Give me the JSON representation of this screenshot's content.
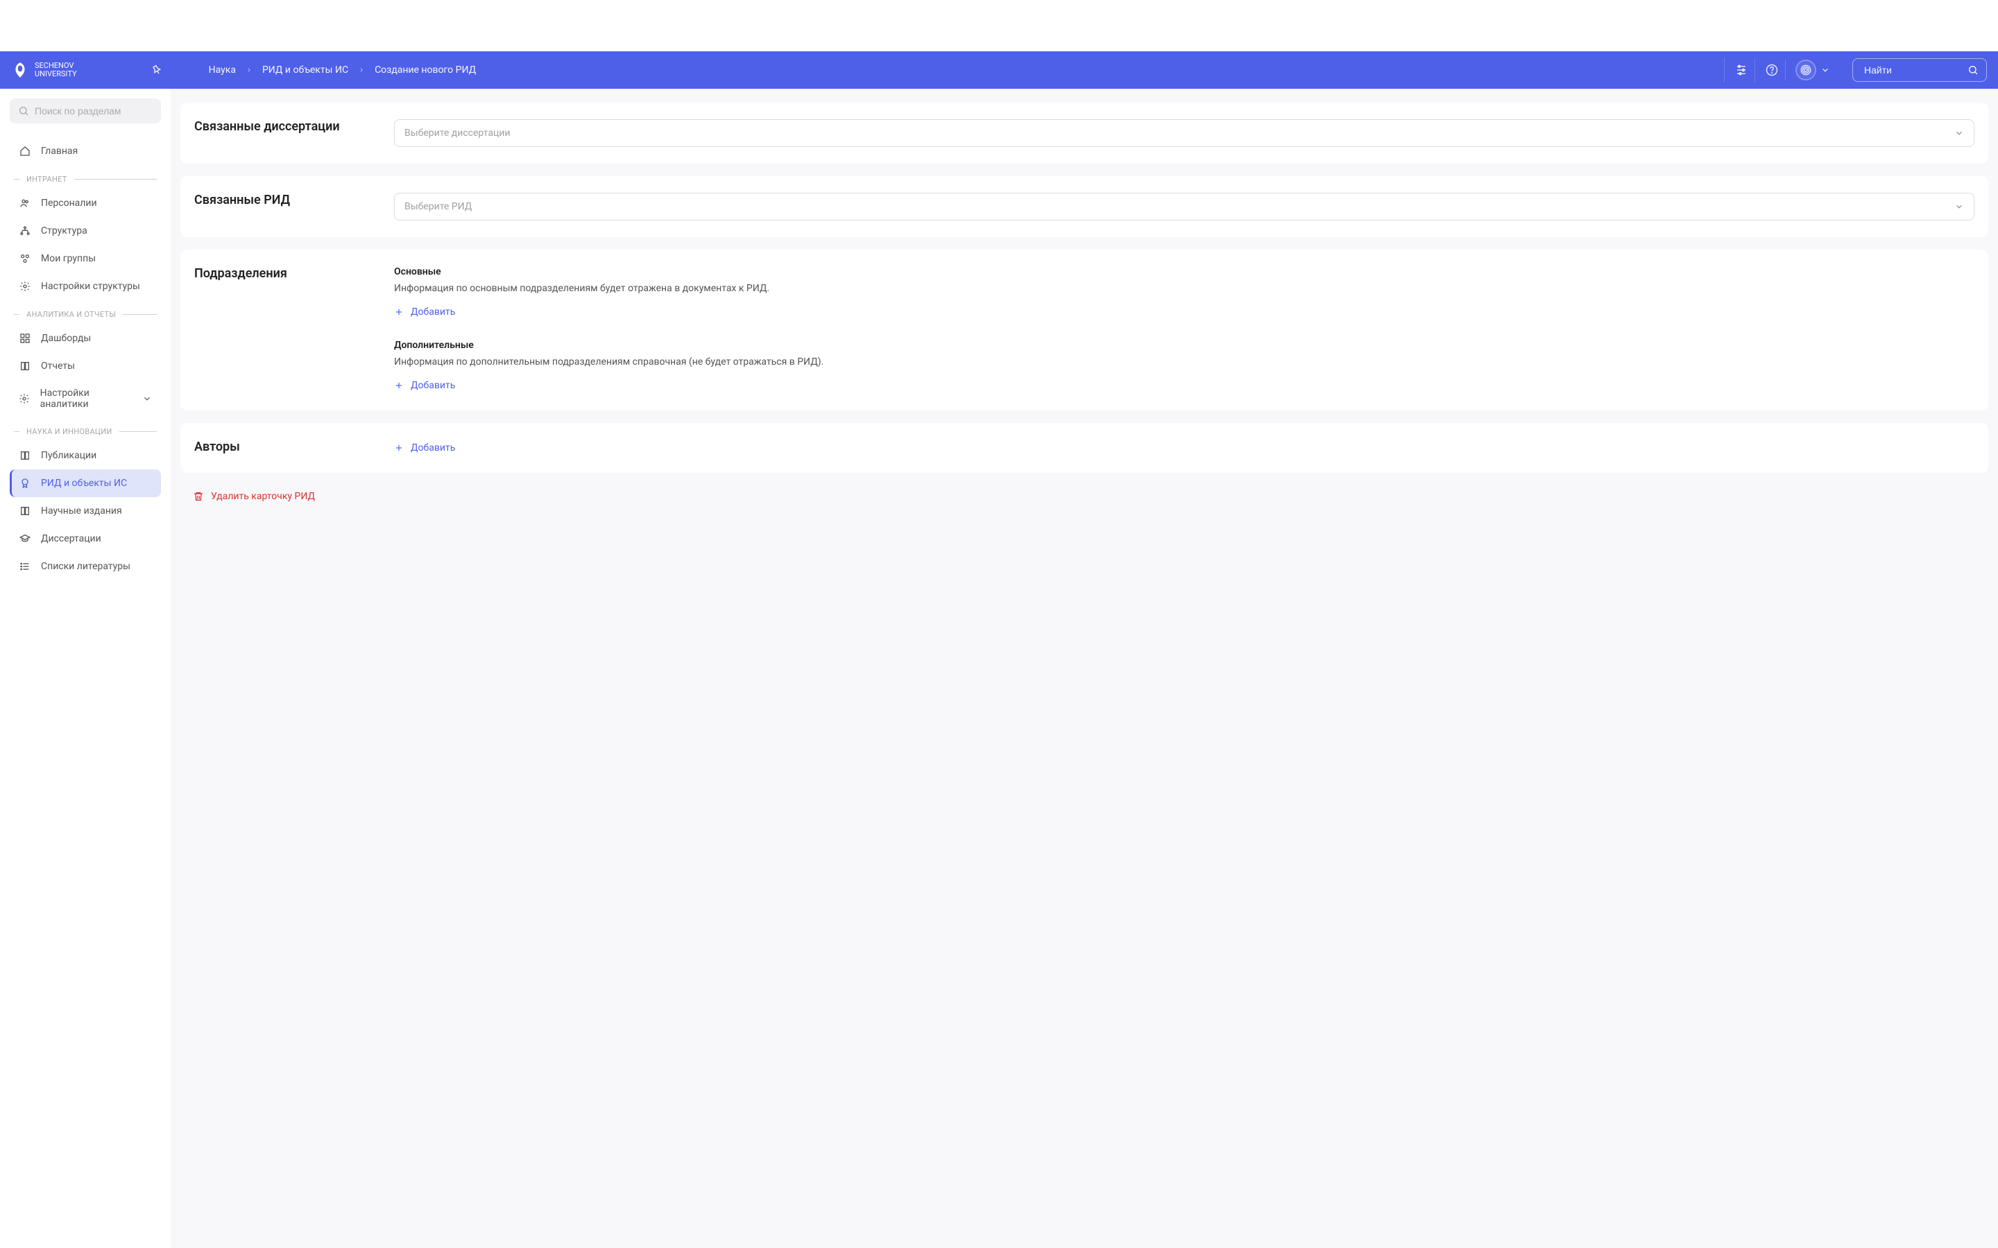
{
  "logoText": "Sechenov\nUniversity",
  "breadcrumb": {
    "item1": "Наука",
    "item2": "РИД и объекты ИС",
    "item3": "Создание нового РИД"
  },
  "headerSearch": {
    "placeholder": "Найти"
  },
  "sidebar": {
    "searchPlaceholder": "Поиск по разделам",
    "home": "Главная",
    "sections": {
      "intranet": "ИНТРАНЕТ",
      "analytics": "АНАЛИТИКА И ОТЧЕТЫ",
      "science": "НАУКА И ИННОВАЦИИ"
    },
    "items": {
      "personnel": "Персоналии",
      "structure": "Структура",
      "myGroups": "Мои группы",
      "structureSettings": "Настройки структуры",
      "dashboards": "Дашборды",
      "reports": "Отчеты",
      "analyticsSettings": "Настройки аналитики",
      "publications": "Публикации",
      "rid": "РИД и объекты ИС",
      "journals": "Научные издания",
      "dissertations": "Диссертации",
      "literature": "Списки литературы"
    }
  },
  "cards": {
    "relatedDissertations": {
      "label": "Связанные диссертации",
      "placeholder": "Выберите диссертации"
    },
    "relatedRid": {
      "label": "Связанные РИД",
      "placeholder": "Выберите РИД"
    },
    "departments": {
      "label": "Подразделения",
      "main": {
        "title": "Основные",
        "desc": "Информация по основным подразделениям будет отражена в документах к РИД."
      },
      "extra": {
        "title": "Дополнительные",
        "desc": "Информация по дополнительным подразделениям справочная (не будет отражаться в РИД)."
      }
    },
    "authors": {
      "label": "Авторы"
    }
  },
  "actions": {
    "add": "Добавить",
    "delete": "Удалить карточку РИД"
  }
}
